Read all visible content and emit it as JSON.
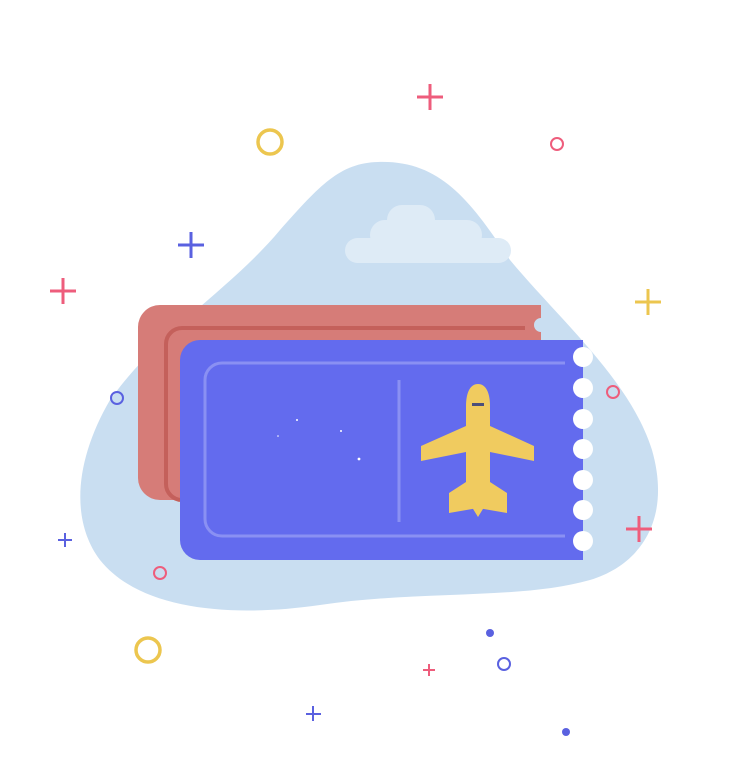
{
  "illustration": {
    "subject": "airplane-ticket",
    "colors": {
      "background": "#ffffff",
      "blob": "#c9def1",
      "cloud": "#deebf6",
      "ticket_back": "#d67c78",
      "ticket_back_line": "#c4605b",
      "ticket_front": "#636bee",
      "ticket_front_line": "#8a90f3",
      "plane": "#f0cb5f",
      "plane_window": "#4b4f7a",
      "accent_pink": "#ee5d7c",
      "accent_yellow": "#ecc64f",
      "accent_blue": "#5a61e0"
    }
  }
}
